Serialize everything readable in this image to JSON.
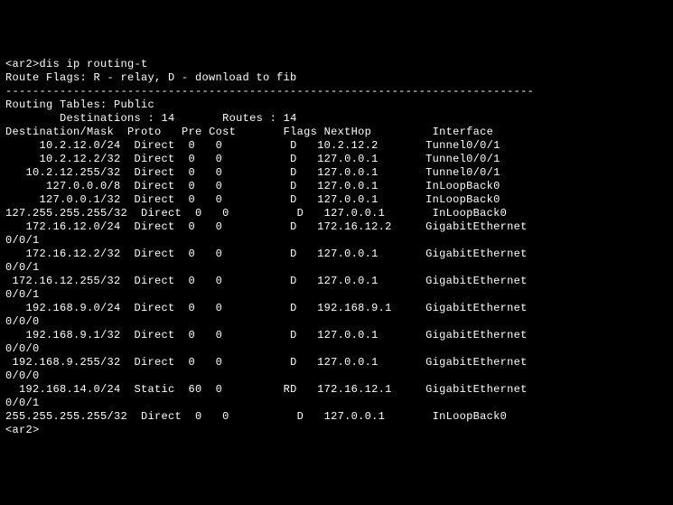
{
  "prompt_open": "<ar2>",
  "command": "dis ip routing-t",
  "flags_line": "Route Flags: R - relay, D - download to fib",
  "divider": "------------------------------------------------------------------------------",
  "table_title": "Routing Tables: Public",
  "dest_label": "Destinations : ",
  "dest_count": "14",
  "routes_label": "Routes : ",
  "routes_count": "14",
  "hdr": {
    "dest": "Destination/Mask",
    "proto": "Proto",
    "pre": "Pre",
    "cost": "Cost",
    "flags": "Flags",
    "nexthop": "NextHop",
    "interface": "Interface"
  },
  "rows": [
    {
      "d": "10.2.12.0/24",
      "p": "Direct",
      "pr": "0",
      "c": "0",
      "f": "D",
      "n": "10.2.12.2",
      "i": "Tunnel0/0/1",
      "wrap": ""
    },
    {
      "d": "10.2.12.2/32",
      "p": "Direct",
      "pr": "0",
      "c": "0",
      "f": "D",
      "n": "127.0.0.1",
      "i": "Tunnel0/0/1",
      "wrap": ""
    },
    {
      "d": "10.2.12.255/32",
      "p": "Direct",
      "pr": "0",
      "c": "0",
      "f": "D",
      "n": "127.0.0.1",
      "i": "Tunnel0/0/1",
      "wrap": ""
    },
    {
      "d": "127.0.0.0/8",
      "p": "Direct",
      "pr": "0",
      "c": "0",
      "f": "D",
      "n": "127.0.0.1",
      "i": "InLoopBack0",
      "wrap": ""
    },
    {
      "d": "127.0.0.1/32",
      "p": "Direct",
      "pr": "0",
      "c": "0",
      "f": "D",
      "n": "127.0.0.1",
      "i": "InLoopBack0",
      "wrap": ""
    },
    {
      "d": "127.255.255.255/32",
      "p": "Direct",
      "pr": "0",
      "c": "0",
      "f": "D",
      "n": "127.0.0.1",
      "i": "InLoopBack0",
      "wrap": ""
    },
    {
      "d": "172.16.12.0/24",
      "p": "Direct",
      "pr": "0",
      "c": "0",
      "f": "D",
      "n": "172.16.12.2",
      "i": "GigabitEthernet",
      "wrap": "0/0/1"
    },
    {
      "d": "172.16.12.2/32",
      "p": "Direct",
      "pr": "0",
      "c": "0",
      "f": "D",
      "n": "127.0.0.1",
      "i": "GigabitEthernet",
      "wrap": "0/0/1"
    },
    {
      "d": "172.16.12.255/32",
      "p": "Direct",
      "pr": "0",
      "c": "0",
      "f": "D",
      "n": "127.0.0.1",
      "i": "GigabitEthernet",
      "wrap": "0/0/1"
    },
    {
      "d": "192.168.9.0/24",
      "p": "Direct",
      "pr": "0",
      "c": "0",
      "f": "D",
      "n": "192.168.9.1",
      "i": "GigabitEthernet",
      "wrap": "0/0/0"
    },
    {
      "d": "192.168.9.1/32",
      "p": "Direct",
      "pr": "0",
      "c": "0",
      "f": "D",
      "n": "127.0.0.1",
      "i": "GigabitEthernet",
      "wrap": "0/0/0"
    },
    {
      "d": "192.168.9.255/32",
      "p": "Direct",
      "pr": "0",
      "c": "0",
      "f": "D",
      "n": "127.0.0.1",
      "i": "GigabitEthernet",
      "wrap": "0/0/0"
    },
    {
      "d": "192.168.14.0/24",
      "p": "Static",
      "pr": "60",
      "c": "0",
      "f": "RD",
      "n": "172.16.12.1",
      "i": "GigabitEthernet",
      "wrap": "0/0/1"
    },
    {
      "d": "255.255.255.255/32",
      "p": "Direct",
      "pr": "0",
      "c": "0",
      "f": "D",
      "n": "127.0.0.1",
      "i": "InLoopBack0",
      "wrap": ""
    }
  ],
  "prompt_close": "<ar2>"
}
